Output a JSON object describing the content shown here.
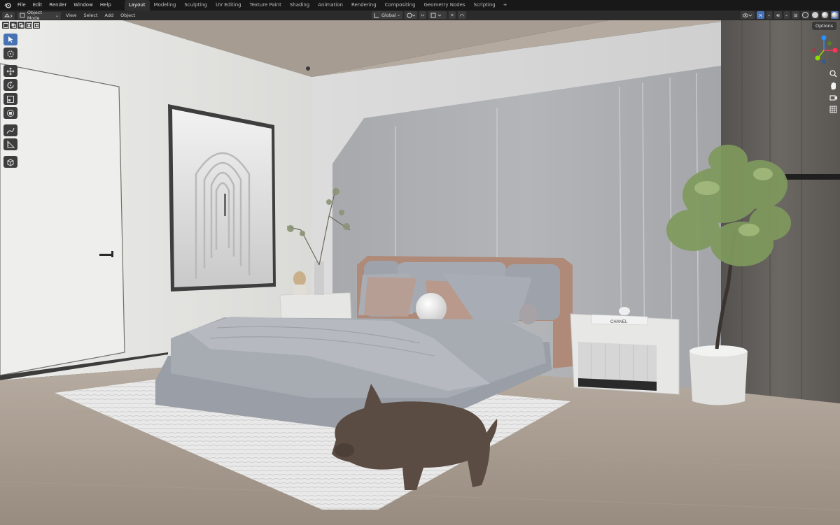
{
  "topbar": {
    "menu": [
      "File",
      "Edit",
      "Render",
      "Window",
      "Help"
    ],
    "workspaces": [
      "Layout",
      "Modeling",
      "Sculpting",
      "UV Editing",
      "Texture Paint",
      "Shading",
      "Animation",
      "Rendering",
      "Compositing",
      "Geometry Nodes",
      "Scripting"
    ],
    "active_workspace": "Layout",
    "add_tab": "+"
  },
  "header": {
    "mode": "Object Mode",
    "menus": [
      "View",
      "Select",
      "Add",
      "Object"
    ],
    "orientation": "Global"
  },
  "viewport": {
    "options_label": "Options",
    "book_text": "CHANEL"
  },
  "gizmo": {
    "axes": [
      "X",
      "Y",
      "Z"
    ],
    "colors": {
      "x": "#ff3352",
      "y": "#8bdc00",
      "z": "#2890ff"
    }
  },
  "tools": [
    "select-box",
    "cursor",
    "move",
    "rotate",
    "scale",
    "transform",
    "annotate",
    "measure",
    "add-cube"
  ],
  "nav_buttons": [
    "zoom",
    "pan",
    "camera-view",
    "perspective-toggle"
  ],
  "colors": {
    "accent": "#4772b3",
    "topbar": "#181818",
    "header": "#2b2b2b"
  }
}
